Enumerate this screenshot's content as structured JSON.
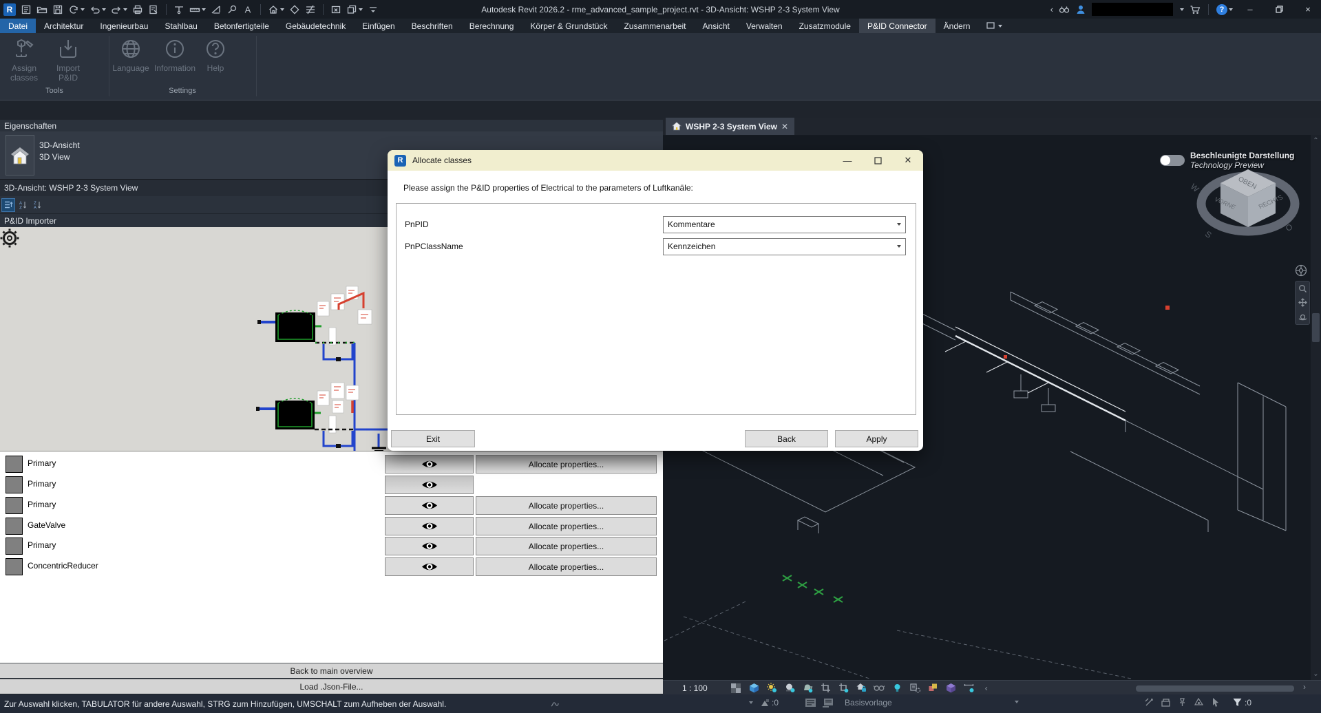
{
  "window": {
    "title": "Autodesk Revit 2026.2 - rme_advanced_sample_project.rvt - 3D-Ansicht: WSHP 2-3 System View"
  },
  "ribbon": {
    "tabs": [
      {
        "label": "Datei"
      },
      {
        "label": "Architektur"
      },
      {
        "label": "Ingenieurbau"
      },
      {
        "label": "Stahlbau"
      },
      {
        "label": "Betonfertigteile"
      },
      {
        "label": "Gebäudetechnik"
      },
      {
        "label": "Einfügen"
      },
      {
        "label": "Beschriften"
      },
      {
        "label": "Berechnung"
      },
      {
        "label": "Körper & Grundstück"
      },
      {
        "label": "Zusammenarbeit"
      },
      {
        "label": "Ansicht"
      },
      {
        "label": "Verwalten"
      },
      {
        "label": "Zusatzmodule"
      },
      {
        "label": "P&ID Connector"
      },
      {
        "label": "Ändern"
      }
    ],
    "panels": [
      {
        "label": "Tools",
        "buttons": [
          "Assign classes",
          "Import P&ID"
        ]
      },
      {
        "label": "Settings",
        "buttons": [
          "Language",
          "Information",
          "Help"
        ]
      }
    ]
  },
  "properties": {
    "header": "Eigenschaften",
    "type_line1": "3D-Ansicht",
    "type_line2": "3D View",
    "view_title": "3D-Ansicht: WSHP 2-3 System View"
  },
  "importer": {
    "header": "P&ID Importer",
    "rows": [
      {
        "label": "Primary"
      },
      {
        "label": "Primary"
      },
      {
        "label": "Primary"
      },
      {
        "label": "GateValve"
      },
      {
        "label": "Primary"
      },
      {
        "label": "ConcentricReducer"
      }
    ],
    "allocate_label": "Allocate properties...",
    "back_label": "Back to main overview",
    "load_label": "Load .Json-File..."
  },
  "dialog": {
    "title": "Allocate classes",
    "message": "Please assign the P&ID properties of Electrical to the parameters of Luftkanäle:",
    "fields": [
      {
        "label": "PnPID",
        "value": "Kommentare"
      },
      {
        "label": "PnPClassName",
        "value": "Kennzeichen"
      }
    ],
    "exit_label": "Exit",
    "back_label": "Back",
    "apply_label": "Apply"
  },
  "view": {
    "tab_label": "WSHP 2-3 System View",
    "toggle_line1": "Beschleunigte Darstellung",
    "toggle_line2": "Technology Preview",
    "cube": {
      "top": "OBEN",
      "front": "VORNE",
      "right": "RECHTS",
      "west": "W",
      "south": "S",
      "east": "O"
    },
    "scale": "1 : 100",
    "template_label": "Basisvorlage",
    "editable_count": ":0",
    "filter_count": ":0"
  },
  "statusbar": {
    "message": "Zur Auswahl klicken, TABULATOR für andere Auswahl, STRG zum Hinzufügen, UMSCHALT zum Aufheben der Auswahl."
  },
  "colors": {
    "accent_blue": "#2465a8",
    "dialog_titlebar": "#f1eecf",
    "canvas_gray": "#d8d7d3",
    "pipe_blue": "#2244cc",
    "equipment_green": "#1f9d2a",
    "alert_red": "#d6402f"
  }
}
